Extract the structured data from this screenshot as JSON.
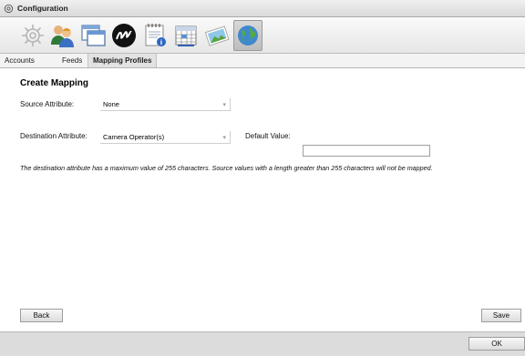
{
  "window": {
    "title": "Configuration"
  },
  "toolbar": {
    "icons": [
      "settings-icon",
      "users-icon",
      "windows-icon",
      "logo-icon",
      "notepad-icon",
      "calendar-icon",
      "image-icon",
      "globe-icon"
    ]
  },
  "tabs": [
    {
      "label": "Accounts"
    },
    {
      "label": "Feeds"
    },
    {
      "label": "Mapping Profiles",
      "active": true
    }
  ],
  "form": {
    "heading": "Create Mapping",
    "source_label": "Source Attribute:",
    "source_value": "None",
    "destination_label": "Destination Attribute:",
    "destination_value": "Camera Operator(s)",
    "default_label": "Default Value:",
    "default_value": "",
    "note": "The destination attribute has a maximum value of 255 characters. Source values with a length greater than 255 characters will not be mapped."
  },
  "buttons": {
    "back": "Back",
    "save": "Save",
    "ok": "OK"
  }
}
